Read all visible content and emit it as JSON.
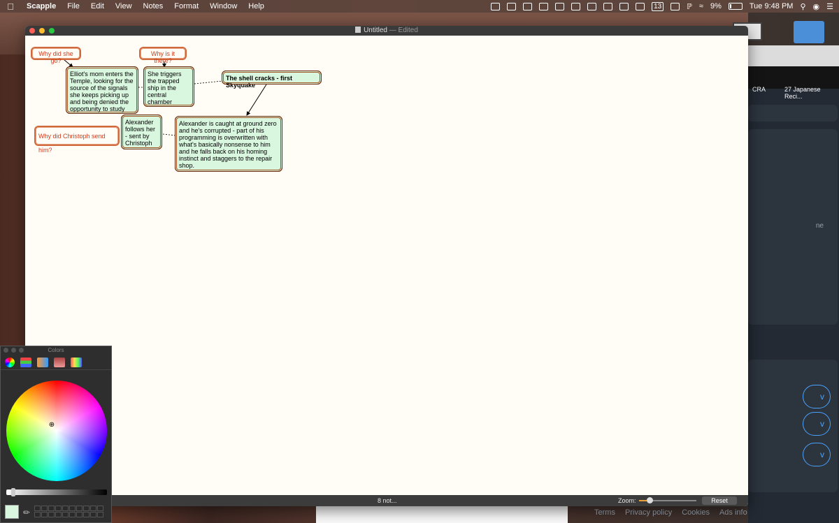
{
  "menubar": {
    "app_name": "Scapple",
    "menus": [
      "File",
      "Edit",
      "View",
      "Notes",
      "Format",
      "Window",
      "Help"
    ],
    "status": {
      "badge": "13",
      "battery": "9%",
      "clock": "Tue 9:48 PM"
    }
  },
  "window": {
    "title": "Untitled",
    "edited": "— Edited"
  },
  "notes": [
    {
      "id": "q1",
      "text": "Why did she go?",
      "kind": "question"
    },
    {
      "id": "q2",
      "text": "Why is it there?",
      "kind": "question"
    },
    {
      "id": "n1",
      "text": "Elliot's mom enters the Temple, looking for the source of the signals she keeps picking up and being denied the opportunity to study",
      "kind": "green"
    },
    {
      "id": "n2",
      "text": "She triggers the trapped ship in the central chamber",
      "kind": "green"
    },
    {
      "id": "n3",
      "text": "The shell cracks - first Skyquake",
      "kind": "green-bold"
    },
    {
      "id": "q3",
      "text": "Why did Christoph send him?",
      "kind": "question"
    },
    {
      "id": "n4",
      "text": "Alexander follows her - sent by Christoph",
      "kind": "green"
    },
    {
      "id": "n5",
      "text": "Alexander is caught at ground zero and he's corrupted - part of his programming is overwritten with what's basically nonsense to him and he falls back on his homing instinct and staggers to the repair shop.",
      "kind": "green"
    }
  ],
  "statusbar": {
    "note_count": "8 not...",
    "zoom_label": "Zoom:",
    "zoom_level": 0.18,
    "reset_label": "Reset"
  },
  "colors_panel": {
    "title": "Colors",
    "selected_color": "#d9f7df",
    "brightness": 0.05
  },
  "browser": {
    "bookmarks": [
      "CRA",
      "27 Japanese Reci..."
    ],
    "pills": [
      "v",
      "v",
      "v"
    ],
    "side_text": "ne",
    "footer_links": [
      "Terms",
      "Privacy policy",
      "Cookies",
      "Ads info"
    ]
  },
  "colors": {
    "note_border": "#a0531f",
    "note_fill": "#d9f7df",
    "question_text": "#d33b1f",
    "canvas": "#fffdf5"
  }
}
